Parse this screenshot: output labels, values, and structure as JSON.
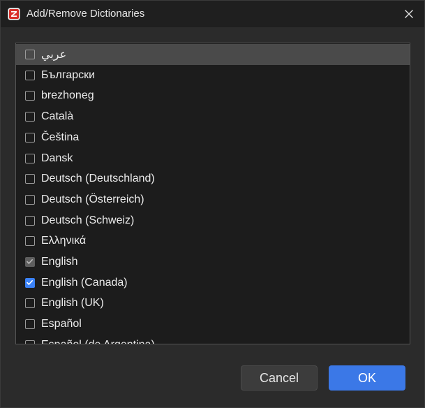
{
  "window": {
    "title": "Add/Remove Dictionaries",
    "app_icon": "zotero-icon",
    "close_icon": "close-icon"
  },
  "dictionaries": [
    {
      "label": "عربي",
      "state": "unchecked",
      "highlighted": true
    },
    {
      "label": "Български",
      "state": "unchecked"
    },
    {
      "label": "brezhoneg",
      "state": "unchecked"
    },
    {
      "label": "Català",
      "state": "unchecked"
    },
    {
      "label": "Čeština",
      "state": "unchecked"
    },
    {
      "label": "Dansk",
      "state": "unchecked"
    },
    {
      "label": "Deutsch (Deutschland)",
      "state": "unchecked"
    },
    {
      "label": "Deutsch (Österreich)",
      "state": "unchecked"
    },
    {
      "label": "Deutsch (Schweiz)",
      "state": "unchecked"
    },
    {
      "label": "Ελληνικά",
      "state": "unchecked"
    },
    {
      "label": "English",
      "state": "checked-disabled"
    },
    {
      "label": "English (Canada)",
      "state": "checked"
    },
    {
      "label": "English (UK)",
      "state": "unchecked"
    },
    {
      "label": "Español",
      "state": "unchecked"
    },
    {
      "label": "Español (de Argentina)",
      "state": "unchecked"
    }
  ],
  "buttons": {
    "cancel_label": "Cancel",
    "ok_label": "OK"
  },
  "colors": {
    "accent": "#3b78e7",
    "checkbox_checked": "#3b82f6",
    "checkbox_disabled": "#5e5e5e",
    "brand_red": "#d9302b"
  }
}
